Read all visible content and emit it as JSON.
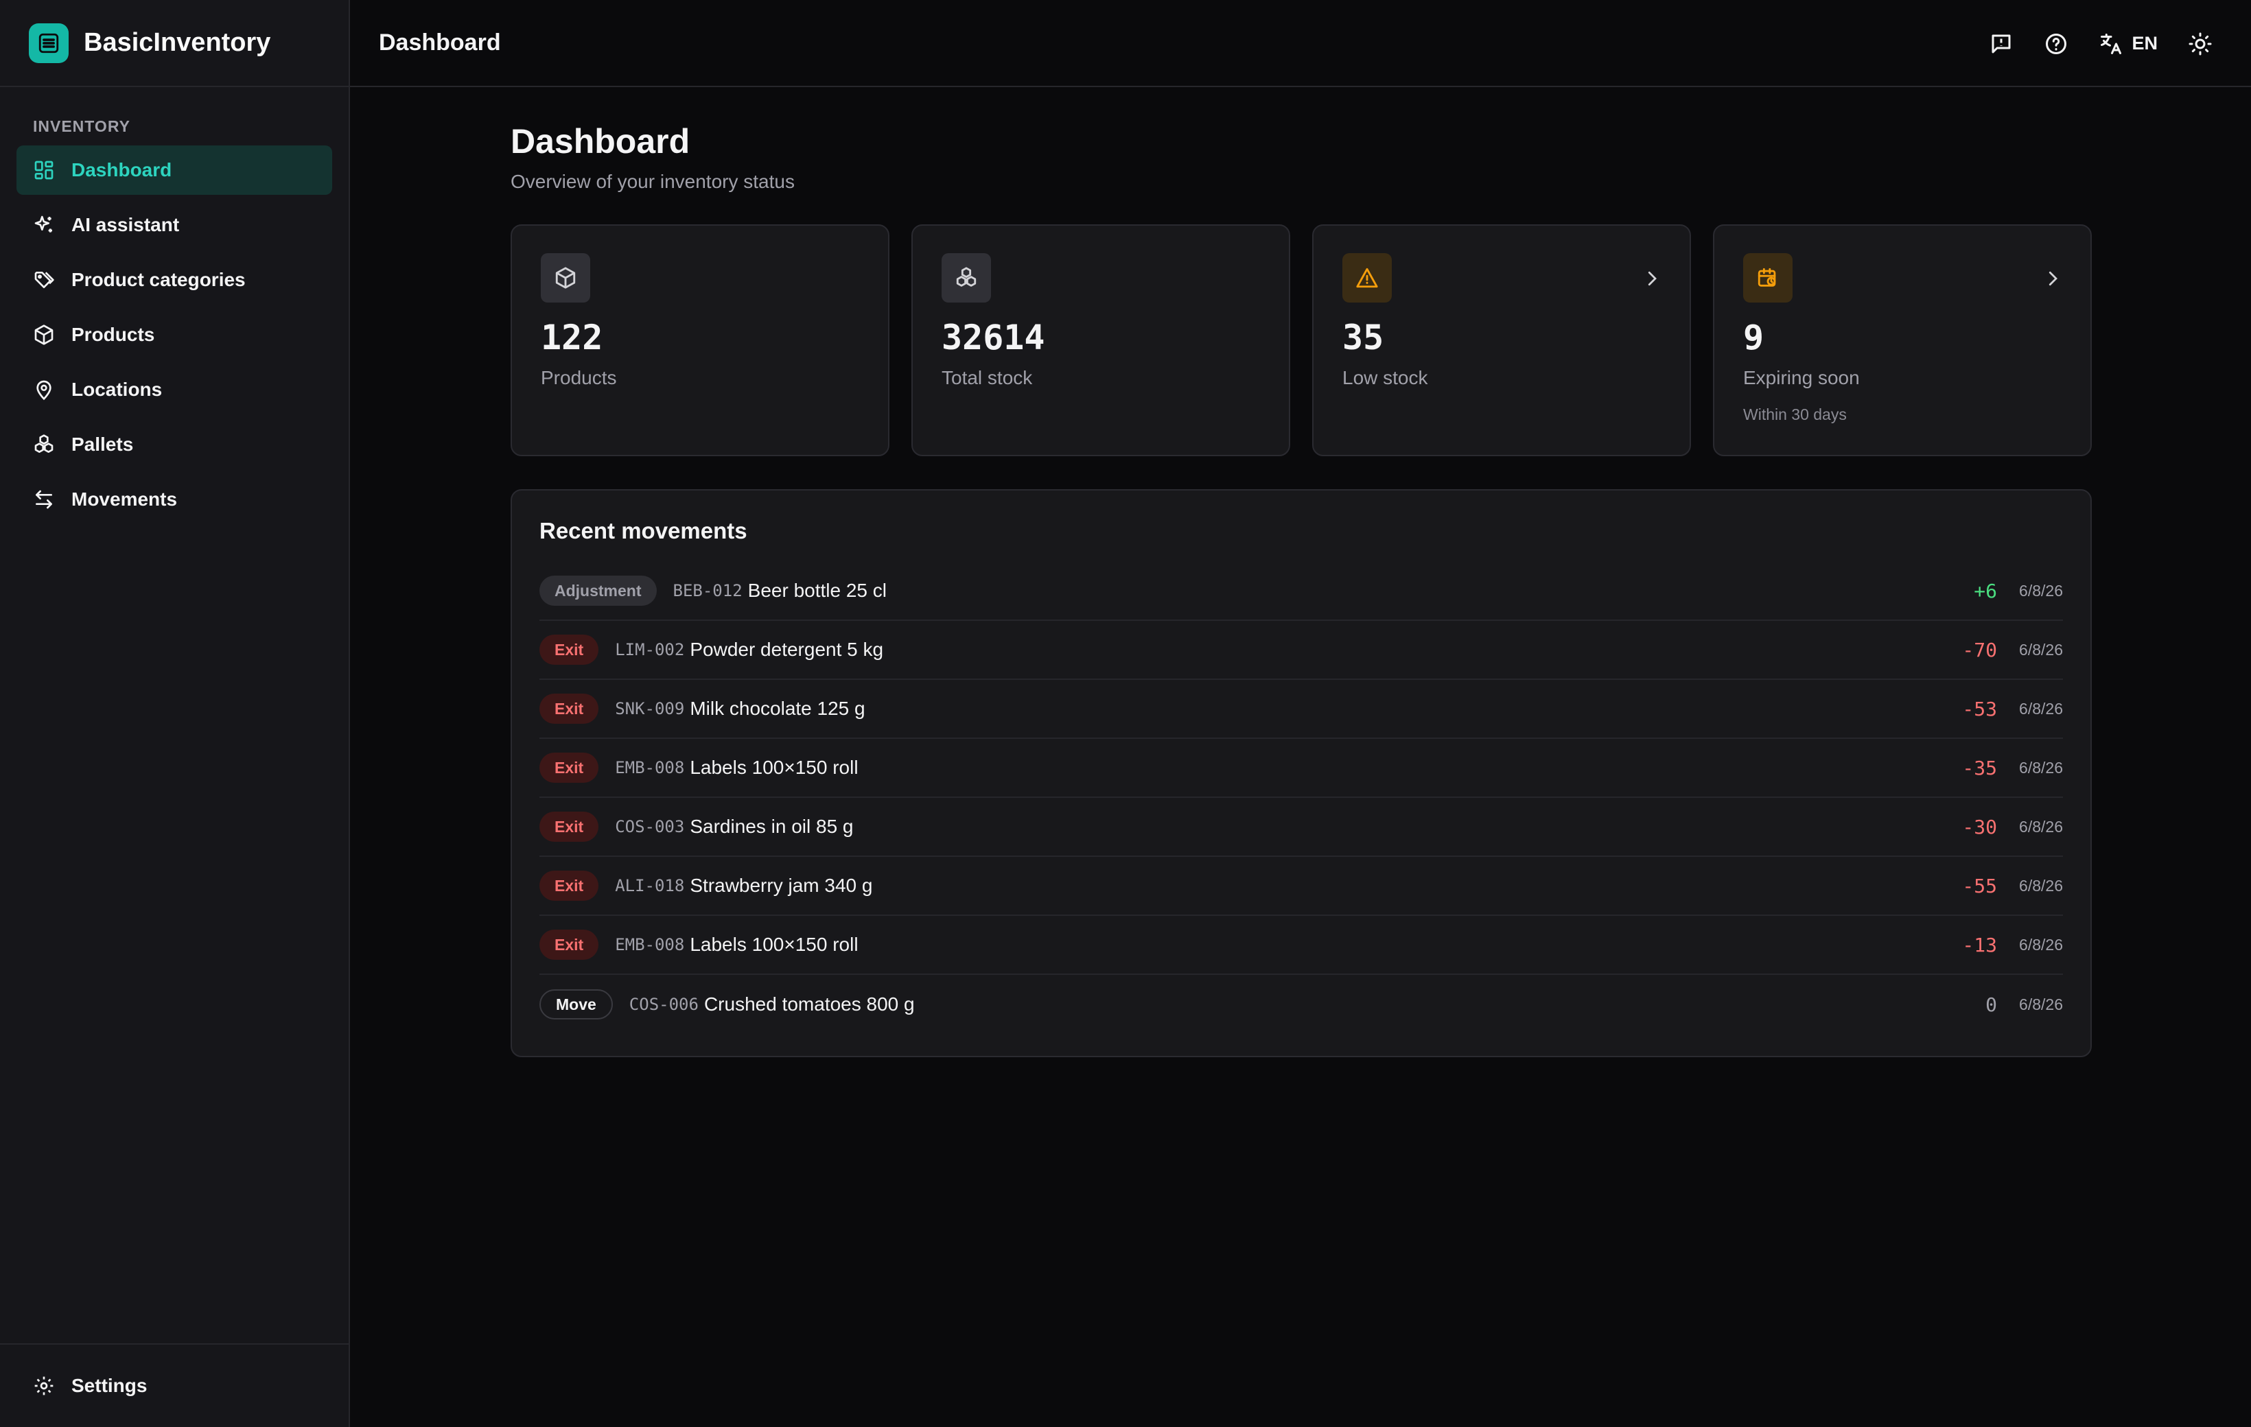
{
  "app": {
    "name": "BasicInventory"
  },
  "sidebar": {
    "section": "INVENTORY",
    "items": [
      {
        "label": "Dashboard",
        "icon": "dashboard-icon",
        "active": true
      },
      {
        "label": "AI assistant",
        "icon": "sparkles-icon"
      },
      {
        "label": "Product categories",
        "icon": "tags-icon"
      },
      {
        "label": "Products",
        "icon": "box-icon"
      },
      {
        "label": "Locations",
        "icon": "map-pin-icon"
      },
      {
        "label": "Pallets",
        "icon": "boxes-icon"
      },
      {
        "label": "Movements",
        "icon": "arrows-icon"
      }
    ],
    "footer": {
      "label": "Settings",
      "icon": "gear-icon"
    }
  },
  "header": {
    "title": "Dashboard",
    "language": "EN"
  },
  "page": {
    "title": "Dashboard",
    "subtitle": "Overview of your inventory status"
  },
  "cards": [
    {
      "value": "122",
      "label": "Products",
      "note": ""
    },
    {
      "value": "32614",
      "label": "Total stock",
      "note": ""
    },
    {
      "value": "35",
      "label": "Low stock",
      "note": ""
    },
    {
      "value": "9",
      "label": "Expiring soon",
      "note": "Within 30 days"
    }
  ],
  "recent": {
    "title": "Recent movements",
    "rows": [
      {
        "type": "Adjustment",
        "sku": "BEB-012",
        "name": "Beer bottle 25 cl",
        "qty": "+6",
        "date": "6/8/26"
      },
      {
        "type": "Exit",
        "sku": "LIM-002",
        "name": "Powder detergent 5 kg",
        "qty": "-70",
        "date": "6/8/26"
      },
      {
        "type": "Exit",
        "sku": "SNK-009",
        "name": "Milk chocolate 125 g",
        "qty": "-53",
        "date": "6/8/26"
      },
      {
        "type": "Exit",
        "sku": "EMB-008",
        "name": "Labels 100×150 roll",
        "qty": "-35",
        "date": "6/8/26"
      },
      {
        "type": "Exit",
        "sku": "COS-003",
        "name": "Sardines in oil 85 g",
        "qty": "-30",
        "date": "6/8/26"
      },
      {
        "type": "Exit",
        "sku": "ALI-018",
        "name": "Strawberry jam 340 g",
        "qty": "-55",
        "date": "6/8/26"
      },
      {
        "type": "Exit",
        "sku": "EMB-008",
        "name": "Labels 100×150 roll",
        "qty": "-13",
        "date": "6/8/26"
      },
      {
        "type": "Move",
        "sku": "COS-006",
        "name": "Crushed tomatoes 800 g",
        "qty": "0",
        "date": "6/8/26"
      }
    ]
  },
  "colors": {
    "accent": "#14b8a6",
    "danger": "#f87171",
    "success": "#4ade80",
    "warning": "#f59e0b"
  }
}
